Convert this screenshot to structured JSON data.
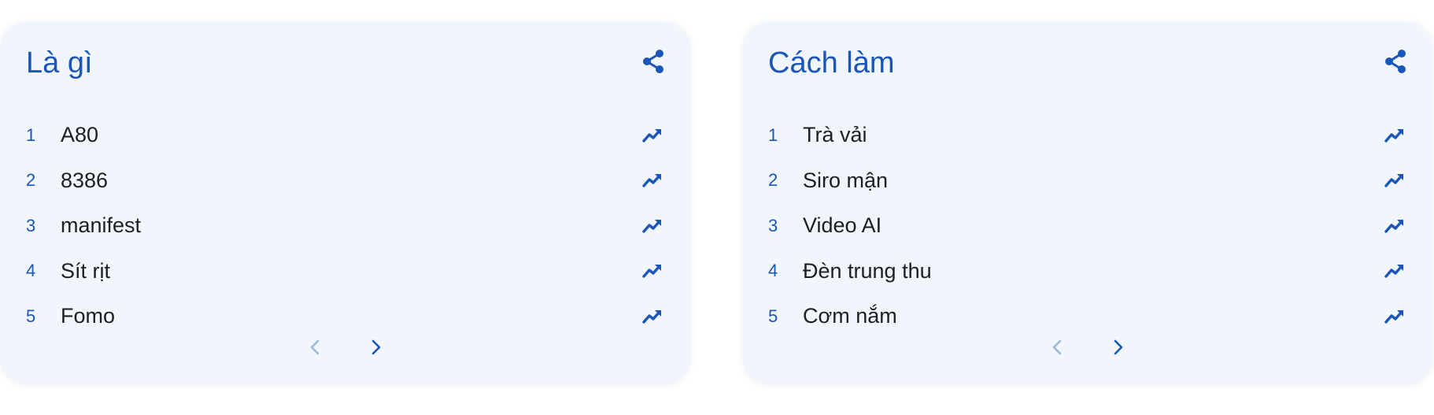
{
  "colors": {
    "accent": "#1a56b8",
    "card_bg": "#f1f6fc",
    "text": "#1f1f1f",
    "disabled_arrow": "#9ab8de"
  },
  "cards": [
    {
      "title": "Là gì",
      "items": [
        {
          "rank": "1",
          "term": "A80",
          "icon": "trending-up-icon"
        },
        {
          "rank": "2",
          "term": "8386",
          "icon": "trending-up-icon"
        },
        {
          "rank": "3",
          "term": "manifest",
          "icon": "trending-up-icon"
        },
        {
          "rank": "4",
          "term": "Sít rịt",
          "icon": "trending-up-icon"
        },
        {
          "rank": "5",
          "term": "Fomo",
          "icon": "trending-up-icon"
        }
      ],
      "share_icon": "share-icon",
      "prev_icon": "chevron-left-icon",
      "next_icon": "chevron-right-icon"
    },
    {
      "title": "Cách làm",
      "items": [
        {
          "rank": "1",
          "term": "Trà vải",
          "icon": "trending-up-icon"
        },
        {
          "rank": "2",
          "term": "Siro mận",
          "icon": "trending-up-icon"
        },
        {
          "rank": "3",
          "term": "Video AI",
          "icon": "trending-up-icon"
        },
        {
          "rank": "4",
          "term": "Đèn trung thu",
          "icon": "trending-up-icon"
        },
        {
          "rank": "5",
          "term": "Cơm nắm",
          "icon": "trending-up-icon"
        }
      ],
      "share_icon": "share-icon",
      "prev_icon": "chevron-left-icon",
      "next_icon": "chevron-right-icon"
    }
  ]
}
